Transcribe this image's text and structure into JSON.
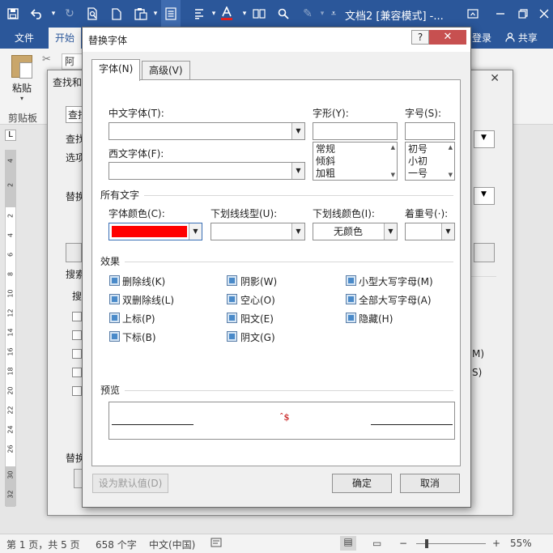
{
  "window": {
    "document_title": "文档2 [兼容模式] -...",
    "qat": {
      "save_icon": "save-icon",
      "undo_icon": "undo-icon",
      "redo_icon": "redo-icon"
    }
  },
  "ribbon": {
    "tabs": [
      "文件",
      "开始"
    ],
    "right_tabs": {
      "login": "登录",
      "share": "共享"
    },
    "paste_label": "粘贴",
    "clipboard_group": "剪贴板",
    "font_box_text": "阿里"
  },
  "ruler": {
    "corner": "L",
    "ticks": [
      "4",
      "2",
      "2",
      "4",
      "6",
      "8",
      "10",
      "12",
      "14",
      "16",
      "18",
      "20",
      "22",
      "24",
      "26",
      "28",
      "30",
      "32"
    ]
  },
  "find_replace": {
    "title": "查找和",
    "tab_label": "查找",
    "find_label": "查找",
    "options_label": "选项",
    "replace_label": "替换",
    "search_label": "搜索",
    "search_sub": "搜",
    "replace_bottom": "替换",
    "right_hint_m": "M)",
    "right_hint_s": "S)"
  },
  "font_dialog": {
    "title": "替换字体",
    "help": "?",
    "tabs": {
      "font": "字体(N)",
      "advanced": "高级(V)"
    },
    "labels": {
      "cn_font": "中文字体(T):",
      "west_font": "西文字体(F):",
      "style": "字形(Y):",
      "size": "字号(S):",
      "all_text": "所有文字",
      "font_color": "字体颜色(C):",
      "underline_type": "下划线线型(U):",
      "underline_color": "下划线颜色(I):",
      "emphasis": "着重号(·):",
      "effects": "效果",
      "preview": "预览"
    },
    "values": {
      "cn_font": "",
      "west_font": "",
      "style": "",
      "size": "",
      "underline_type": "",
      "emphasis": ""
    },
    "style_list": [
      "常规",
      "倾斜",
      "加粗"
    ],
    "size_list": [
      "初号",
      "小初",
      "一号"
    ],
    "font_color_value": "#ff0000",
    "underline_color_value": "无颜色",
    "effects": {
      "strikethrough": "删除线(K)",
      "double_strikethrough": "双删除线(L)",
      "superscript": "上标(P)",
      "subscript": "下标(B)",
      "shadow": "阴影(W)",
      "outline": "空心(O)",
      "emboss": "阳文(E)",
      "engrave": "阴文(G)",
      "small_caps": "小型大写字母(M)",
      "all_caps": "全部大写字母(A)",
      "hidden": "隐藏(H)"
    },
    "preview_text": "ˆ$",
    "buttons": {
      "set_default": "设为默认值(D)",
      "ok": "确定",
      "cancel": "取消"
    }
  },
  "statusbar": {
    "page": "第 1 页，共 5 页",
    "words": "658 个字",
    "language": "中文(中国)",
    "zoom": "55%"
  }
}
